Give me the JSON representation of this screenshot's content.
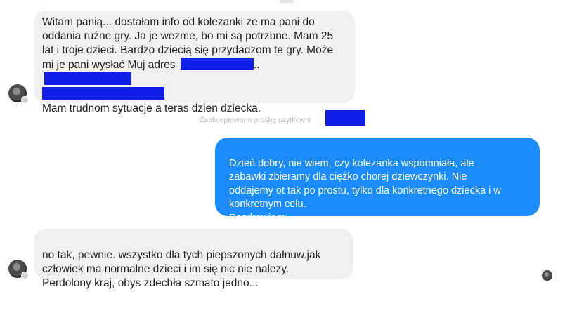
{
  "conversation": {
    "message1": {
      "line1": "Witam panią... dostałam info od kolezanki ze ma pani do",
      "line2": "oddania rużne gry. Ja je wezme, bo mi są potrzbne. Mam 25",
      "line3": "lat i troje dzieci. Bardzo dziecią się przydadzom te gry. Może",
      "line4": "mi je pani wysłać Muj adres",
      "line4_sep": "..",
      "line6": "Mam trudnom sytuacje a teras dzien dziecka."
    },
    "system_notice": "Zaakceptowano prośbę użytkowni",
    "message2": {
      "text": "Dzień dobry, nie wiem, czy koleżanka wspomniała, ale\nzabawki zbieramy dla ciężko chorej dziewczynki. Nie\noddajemy ot tak po prostu, tylko dla konkretnego dziecka i w\nkonkretnym celu.\nPozdrawiam."
    },
    "message3": {
      "text": "no tak, pewnie. wszystko dla tych piepszonych dałnuw.jak\nczłowiek ma normalne dzieci i im się nic nie nalezy.\nPerdolony kraj, obys zdechła szmato jedno..."
    }
  },
  "colors": {
    "outgoing_bubble": "#1a8cff",
    "incoming_bubble": "#f0f0f0",
    "redaction": "#1020e8"
  }
}
